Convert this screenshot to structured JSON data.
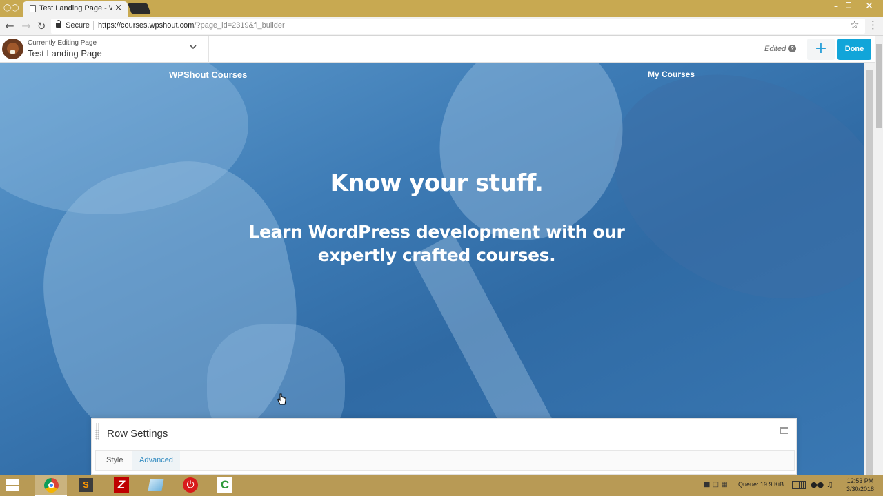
{
  "browser": {
    "tab_title": "Test Landing Page - WPS",
    "secure_label": "Secure",
    "url_host": "https://courses.wpshout.com",
    "url_path": "/?page_id=2319&fl_builder"
  },
  "builder": {
    "editing_label": "Currently Editing Page",
    "page_name": "Test Landing Page",
    "status": "Edited",
    "add_symbol": "+",
    "done_label": "Done"
  },
  "site": {
    "title": "WPShout Courses",
    "nav_item": "My Courses",
    "heading": "Know your stuff.",
    "subheading_line1": "Learn WordPress development with our",
    "subheading_line2": "expertly crafted courses."
  },
  "panel": {
    "title": "Row Settings",
    "tabs": [
      "Style",
      "Advanced"
    ],
    "active_tab": "Advanced"
  },
  "taskbar": {
    "apps": [
      "chrome-icon",
      "sublime-text-icon",
      "filezilla-icon",
      "file-explorer-icon",
      "power-icon",
      "camtasia-icon"
    ],
    "active_app": "chrome-icon",
    "queue": "Queue: 19.9 KiB",
    "time": "12:53 PM",
    "date": "3/30/2018"
  },
  "colors": {
    "hero_overlay": "#3b7bb3",
    "done_button": "#11a5d9",
    "accent": "#29a0d8",
    "tabstrip": "#c8a951"
  }
}
